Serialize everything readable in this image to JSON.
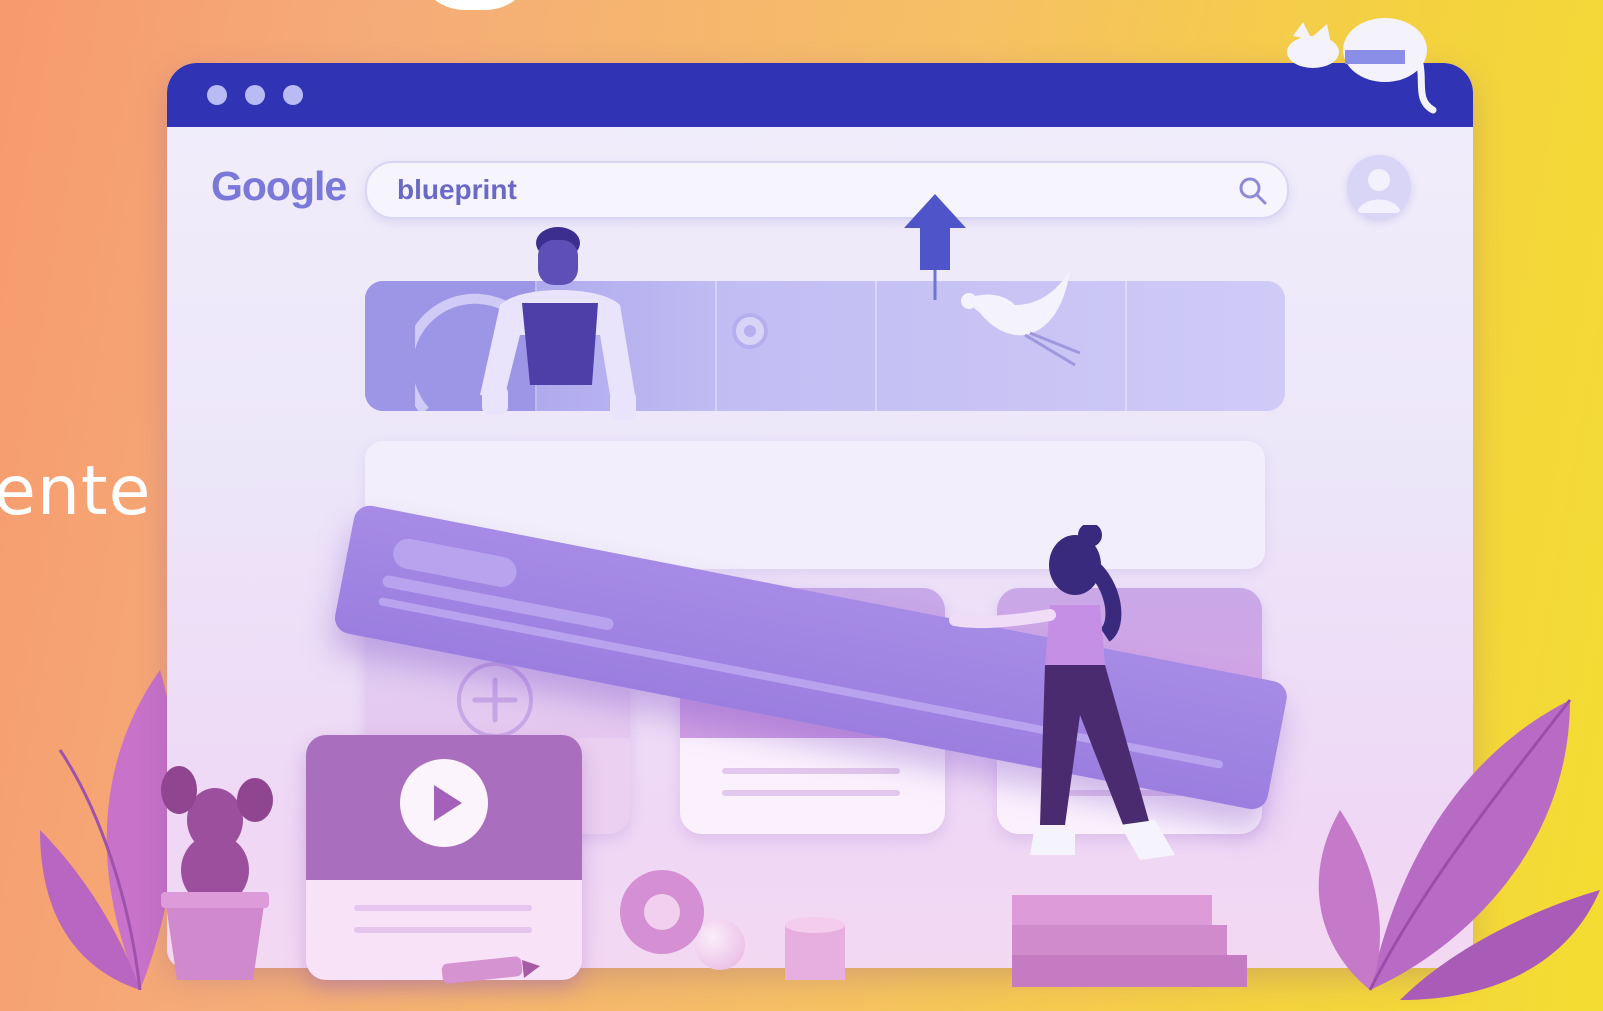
{
  "edge_text": "ente",
  "window": {
    "logo": "Google",
    "search": {
      "query": "blueprint",
      "icon": "search-icon"
    },
    "avatar_icon": "user-avatar-icon"
  },
  "colors": {
    "titlebar": "#3033b3",
    "accent": "#7a78d8",
    "plank": "#9b7edf",
    "background_left": "#f79a6e",
    "background_right": "#f4dd32"
  }
}
